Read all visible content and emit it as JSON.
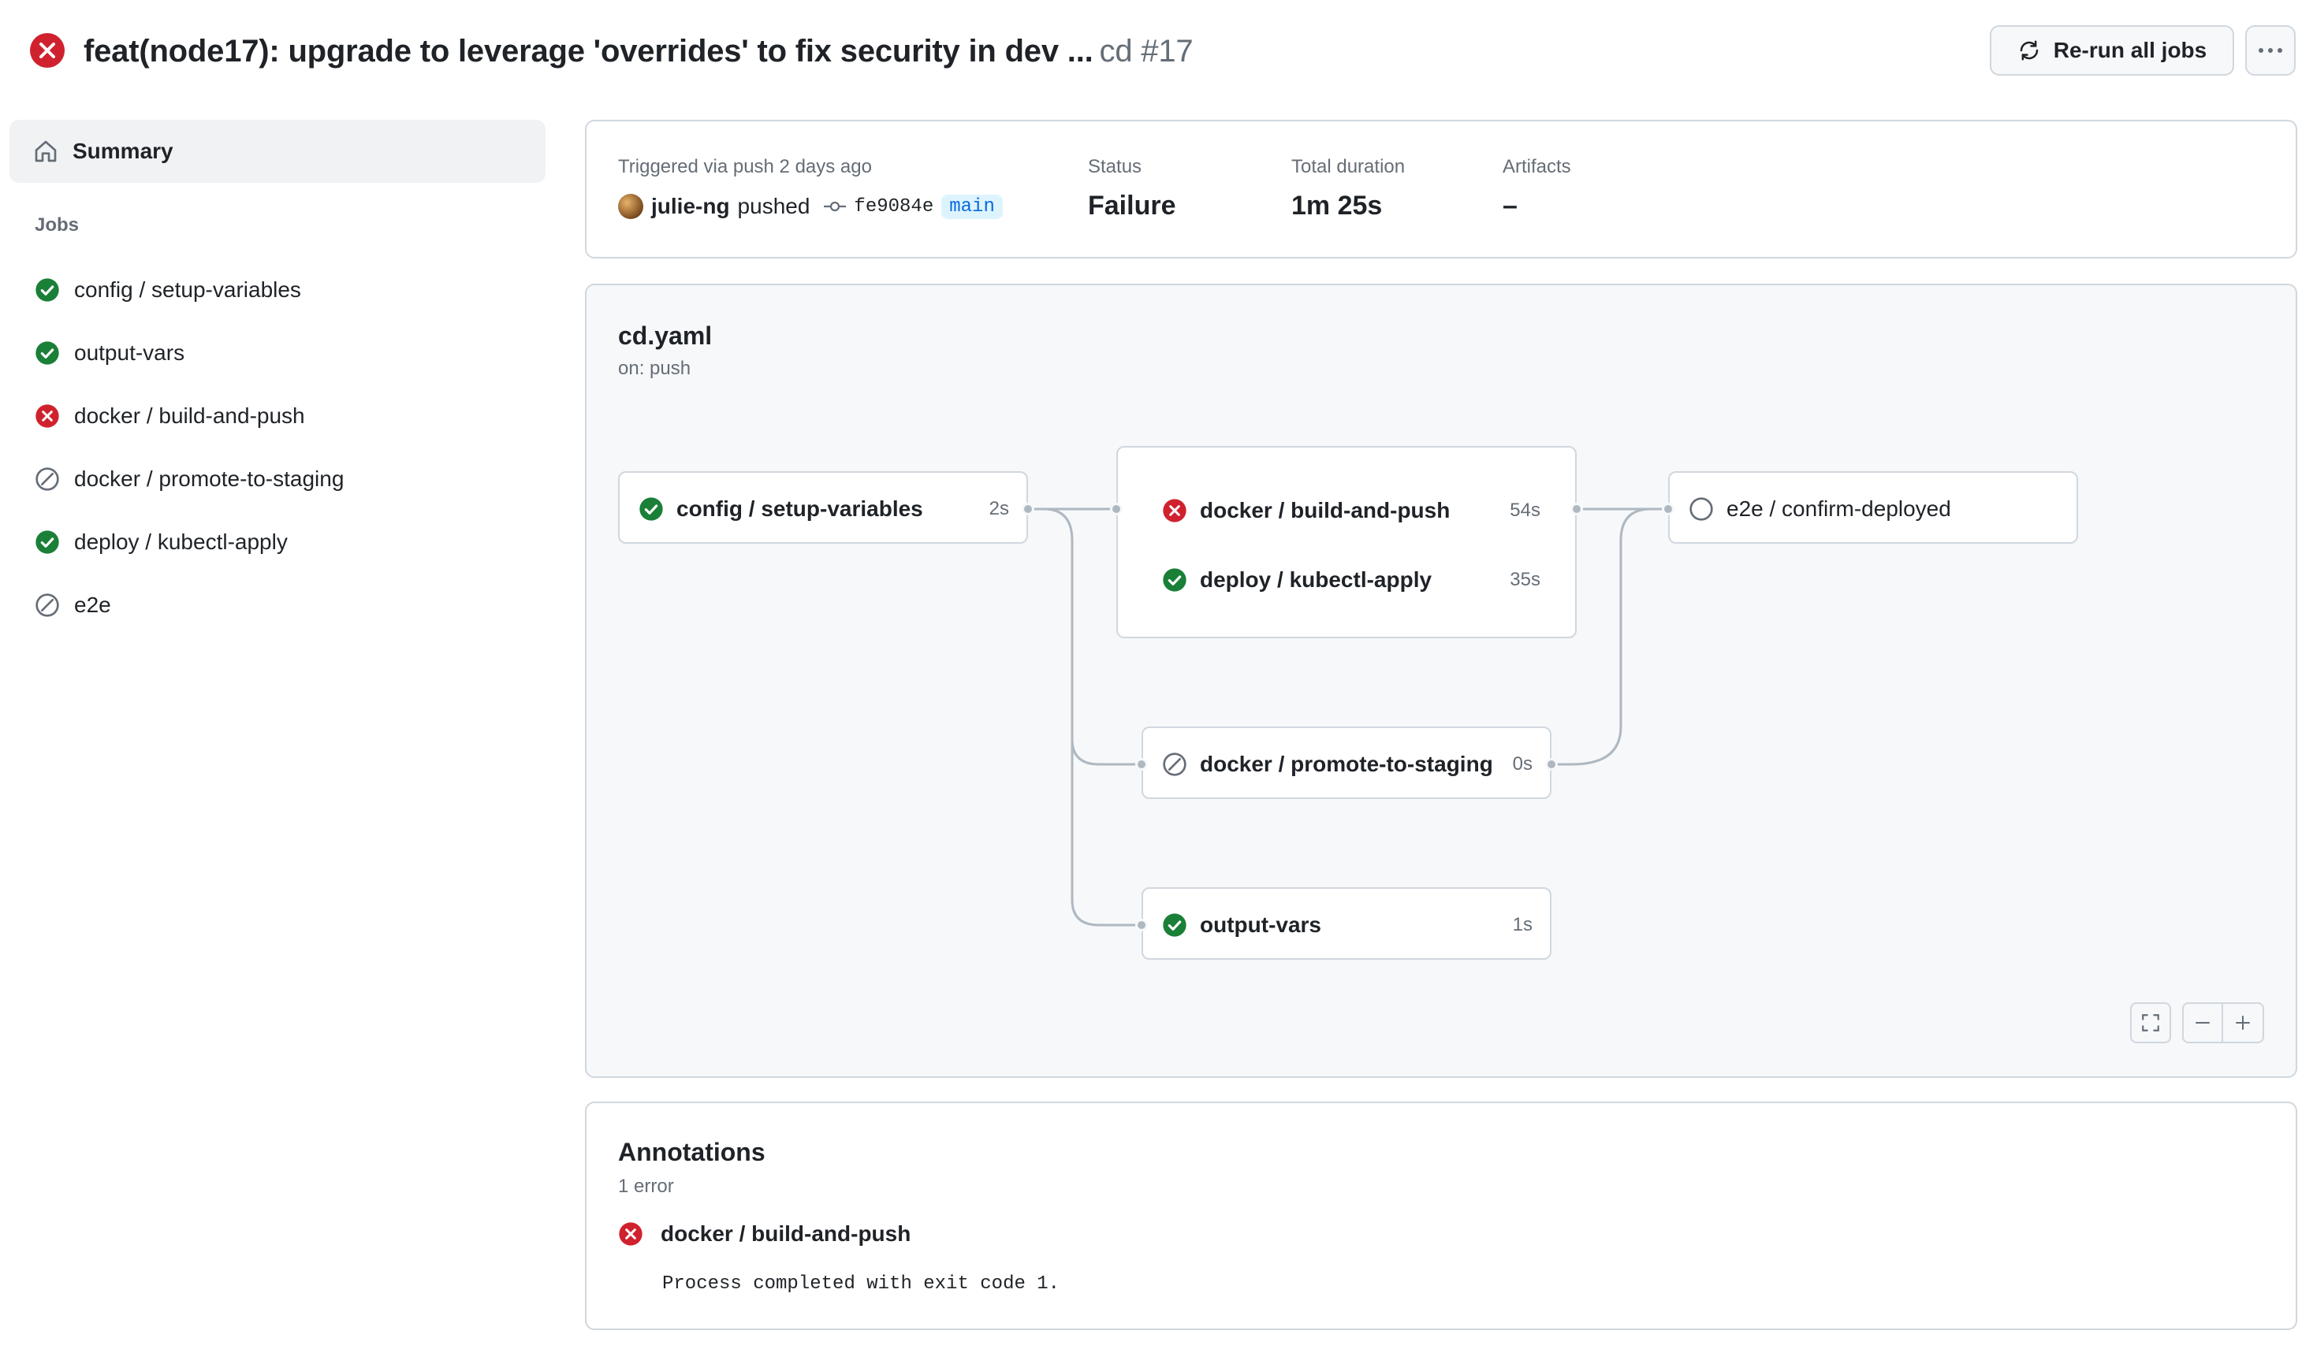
{
  "header": {
    "title": "feat(node17): upgrade to leverage 'overrides' to fix security in dev ...",
    "workflow_ref": "cd #17",
    "status_icon": "x-circle-fill-icon",
    "rerun_label": "Re-run all jobs",
    "more_icon": "kebab-horizontal-icon"
  },
  "sidebar": {
    "summary_label": "Summary",
    "jobs_heading": "Jobs",
    "jobs": [
      {
        "label": "config / setup-variables",
        "status": "success"
      },
      {
        "label": "output-vars",
        "status": "success"
      },
      {
        "label": "docker / build-and-push",
        "status": "failure"
      },
      {
        "label": "docker / promote-to-staging",
        "status": "skipped"
      },
      {
        "label": "deploy / kubectl-apply",
        "status": "success"
      },
      {
        "label": "e2e",
        "status": "skipped"
      }
    ]
  },
  "run_summary": {
    "trigger_label": "Triggered via push 2 days ago",
    "actor": "julie-ng",
    "action": "pushed",
    "commit_sha": "fe9084e",
    "branch": "main",
    "status_label": "Status",
    "status_value": "Failure",
    "duration_label": "Total duration",
    "duration_value": "1m 25s",
    "artifacts_label": "Artifacts",
    "artifacts_value": "–"
  },
  "graph": {
    "file": "cd.yaml",
    "trigger": "on: push",
    "jobs": {
      "setup": {
        "label": "config / setup-variables",
        "duration": "2s",
        "status": "success"
      },
      "build": {
        "label": "docker / build-and-push",
        "duration": "54s",
        "status": "failure"
      },
      "deploy": {
        "label": "deploy / kubectl-apply",
        "duration": "35s",
        "status": "success"
      },
      "e2e": {
        "label": "e2e / confirm-deployed",
        "duration": "",
        "status": "pending"
      },
      "promote": {
        "label": "docker / promote-to-staging",
        "duration": "0s",
        "status": "skipped"
      },
      "output": {
        "label": "output-vars",
        "duration": "1s",
        "status": "success"
      }
    }
  },
  "annotations": {
    "title": "Annotations",
    "count": "1 error",
    "items": [
      {
        "job": "docker / build-and-push",
        "message": "Process completed with exit code 1.",
        "level": "error"
      }
    ]
  },
  "colors": {
    "success": "#1a7f37",
    "failure": "#cf222e",
    "muted": "#656d76",
    "border": "#d0d7de",
    "accent": "#0969da"
  }
}
